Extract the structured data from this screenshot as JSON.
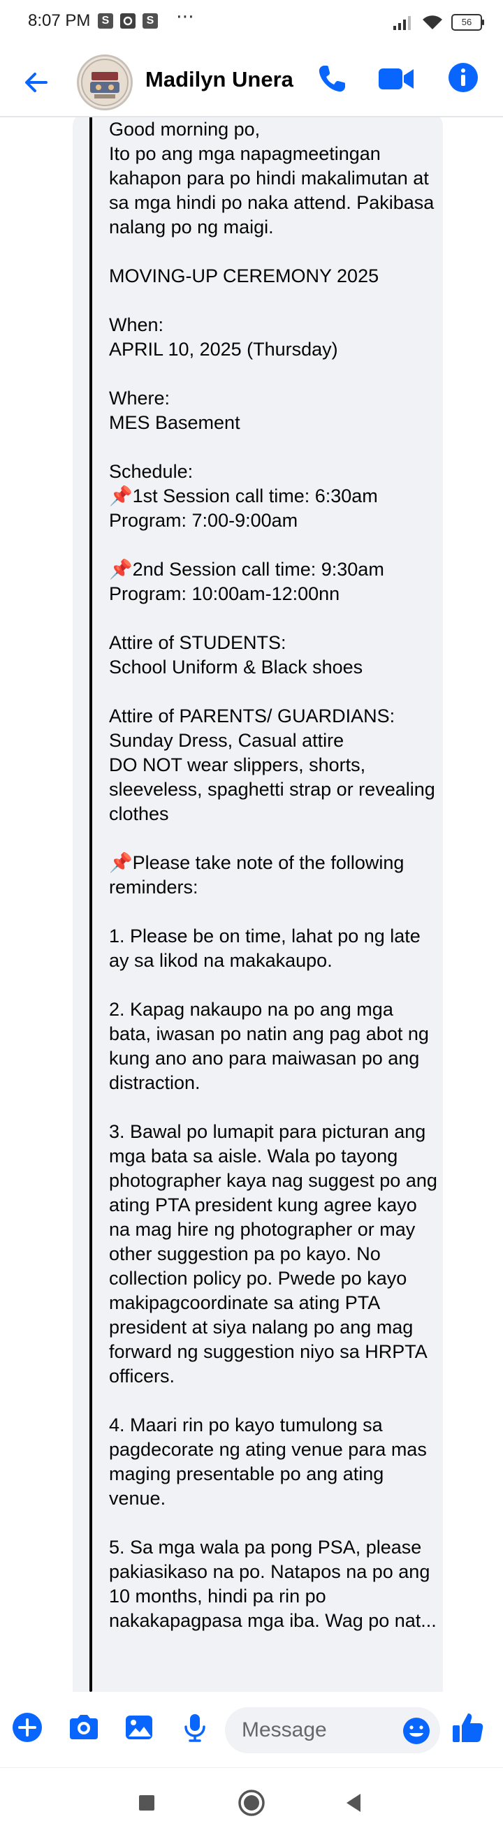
{
  "status_bar": {
    "time": "8:07 PM",
    "notification_icons": [
      "S",
      "S"
    ],
    "more_indicator": "⋯",
    "battery": "56",
    "icon_names": [
      "signal-icon",
      "wifi-icon",
      "battery-icon"
    ]
  },
  "header": {
    "contact_name": "Madilyn Unera",
    "icons": [
      "back-arrow-icon",
      "phone-icon",
      "video-camera-icon",
      "info-icon"
    ],
    "accent_color": "#0866ff"
  },
  "conversation": {
    "bubble_color": "#f0f2f5",
    "message": "Good morning po,\nIto po ang mga napagmeetingan kahapon para po hindi makalimutan at sa mga hindi po naka attend. Pakibasa nalang po ng maigi.\n\nMOVING-UP CEREMONY 2025\n\nWhen:\nAPRIL 10, 2025 (Thursday)\n\nWhere:\nMES Basement\n\nSchedule:\n📌1st Session call time: 6:30am\nProgram: 7:00-9:00am\n\n📌2nd Session call time: 9:30am\nProgram: 10:00am-12:00nn\n\nAttire of STUDENTS:\nSchool Uniform & Black shoes\n\nAttire of PARENTS/ GUARDIANS:\nSunday Dress, Casual attire\nDO NOT wear slippers, shorts, sleeveless, spaghetti strap or revealing clothes\n\n📌Please take note of the following reminders:\n\n1. Please be on time, lahat po ng late ay sa likod na makakaupo.\n\n2. Kapag nakaupo na po ang mga bata, iwasan po natin ang pag abot ng kung ano ano para maiwasan po ang distraction.\n\n3. Bawal po lumapit para picturan ang mga bata sa aisle. Wala po tayong photographer kaya nag suggest po ang ating PTA president kung agree kayo na mag hire ng photographer or may other suggestion pa po kayo. No collection policy po. Pwede po kayo makipagcoordinate sa ating PTA president at siya nalang po ang mag forward ng suggestion niyo sa HRPTA officers.\n\n4. Maari rin po kayo tumulong sa pagdecorate ng ating venue para mas maging presentable po ang ating venue.\n\n5. Sa mga wala pa pong PSA, please pakiasikaso na po. Natapos na po ang 10 months, hindi pa rin po nakakapagpasa mga iba. Wag po nat..."
  },
  "composer": {
    "placeholder": "Message",
    "icons": [
      "plus-icon",
      "camera-icon",
      "image-icon",
      "microphone-icon",
      "emoji-icon",
      "thumbs-up-icon"
    ]
  },
  "nav_bar": {
    "icons": [
      "recents-square-icon",
      "home-circle-icon",
      "back-triangle-icon"
    ]
  }
}
